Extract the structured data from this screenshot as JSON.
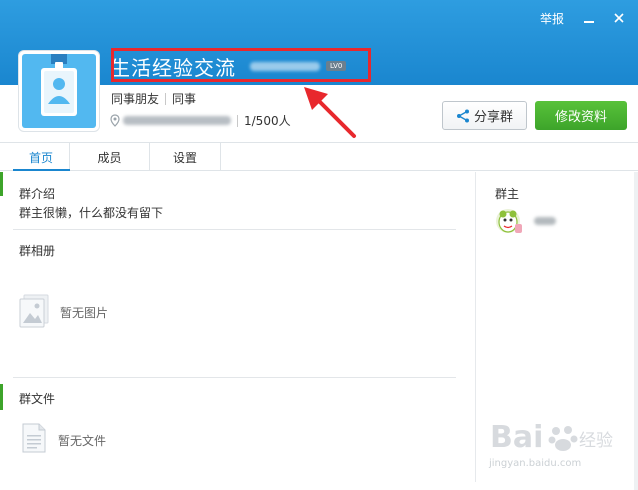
{
  "header": {
    "report_label": "举报",
    "group_name": "生活经验交流",
    "level_badge": "LV0"
  },
  "info": {
    "tags": [
      "同事朋友",
      "同事"
    ],
    "member_count": "1/500人"
  },
  "buttons": {
    "share_label": "分享群",
    "edit_label": "修改资料"
  },
  "tabs": [
    {
      "label": "首页",
      "active": true
    },
    {
      "label": "成员",
      "active": false
    },
    {
      "label": "设置",
      "active": false
    }
  ],
  "sections": {
    "intro": {
      "title": "群介绍",
      "body": "群主很懒，什么都没有留下"
    },
    "album": {
      "title": "群相册",
      "empty": "暂无图片"
    },
    "files": {
      "title": "群文件",
      "empty": "暂无文件"
    },
    "owner": {
      "title": "群主"
    }
  },
  "watermark": {
    "brand": "Bai",
    "brand_suffix": "经验",
    "url": "jingyan.baidu.com"
  },
  "colors": {
    "header_blue": "#1a86cf",
    "accent_green": "#3da42a",
    "highlight_red": "#e8282d"
  },
  "icons": {
    "minimize": "minimize-icon",
    "close": "close-icon",
    "share": "share-icon",
    "location": "location-pin-icon",
    "avatar": "id-card-icon",
    "album_empty": "image-placeholder-icon",
    "file_empty": "document-icon",
    "owner_avatar": "cartoon-avatar-icon"
  }
}
